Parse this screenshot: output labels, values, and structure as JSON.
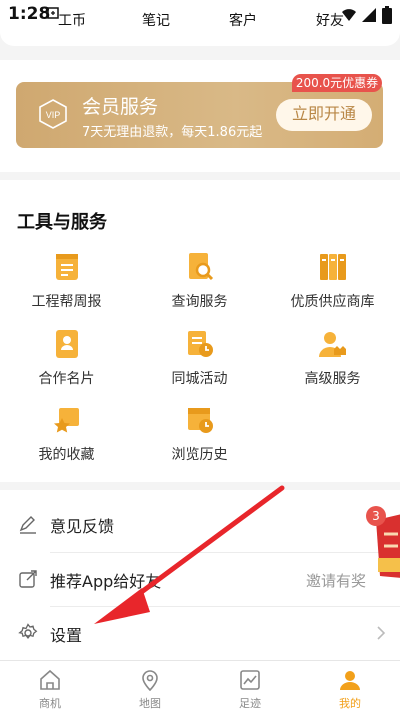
{
  "status_bar": {
    "time": "1:28"
  },
  "top_tabs": [
    "工币",
    "笔记",
    "客户",
    "好友"
  ],
  "vip": {
    "title": "会员服务",
    "badge": "VIP",
    "desc": "7天无理由退款，每天1.86元起",
    "button": "立即开通",
    "coupon": "200.0元优惠券"
  },
  "tools": {
    "title": "工具与服务",
    "items": [
      {
        "label": "工程帮周报",
        "icon": "weekly-report-icon"
      },
      {
        "label": "查询服务",
        "icon": "search-doc-icon"
      },
      {
        "label": "优质供应商库",
        "icon": "supplier-library-icon"
      },
      {
        "label": "合作名片",
        "icon": "business-card-icon"
      },
      {
        "label": "同城活动",
        "icon": "local-event-icon"
      },
      {
        "label": "高级服务",
        "icon": "premium-service-icon"
      },
      {
        "label": "我的收藏",
        "icon": "favorites-icon"
      },
      {
        "label": "浏览历史",
        "icon": "history-icon"
      }
    ]
  },
  "list": [
    {
      "label": "意见反馈",
      "icon": "pencil-icon",
      "right": ""
    },
    {
      "label": "推荐App给好友",
      "icon": "share-icon",
      "right": "邀请有奖"
    },
    {
      "label": "设置",
      "icon": "gear-icon",
      "right": ""
    }
  ],
  "promo": {
    "count": "3"
  },
  "bottom_nav": [
    {
      "label": "商机",
      "icon": "home-icon"
    },
    {
      "label": "地图",
      "icon": "map-pin-icon"
    },
    {
      "label": "足迹",
      "icon": "chart-icon"
    },
    {
      "label": "我的",
      "icon": "person-icon",
      "active": true
    }
  ],
  "colors": {
    "accent": "#f2a01a",
    "vip_gold": "#d4ad74",
    "coupon_red": "#e8534c",
    "arrow_red": "#e8262b"
  }
}
